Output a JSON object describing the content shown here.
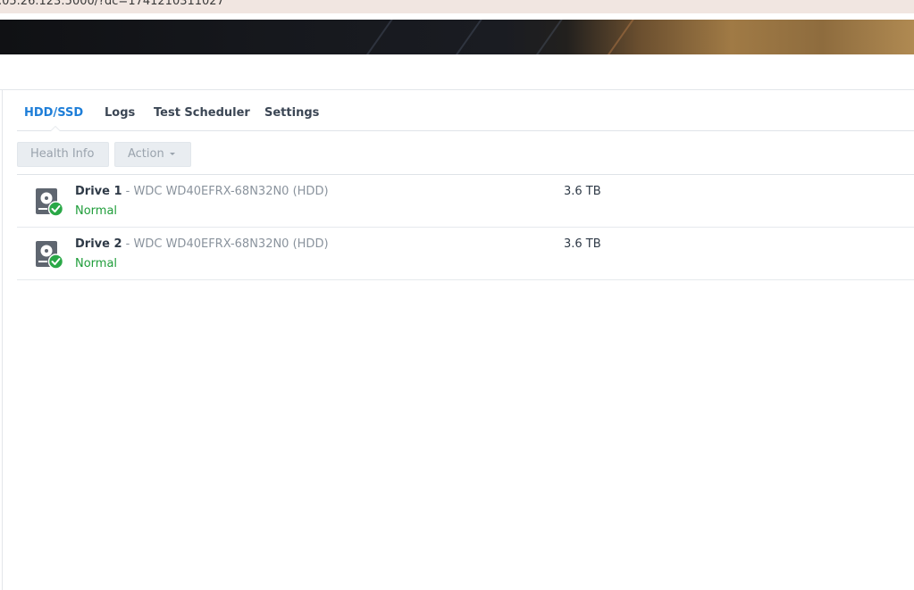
{
  "browser": {
    "url_fragment": ".05.26.123:5000/?dc=1741210311027"
  },
  "tabs": [
    {
      "label": "HDD/SSD",
      "active": true
    },
    {
      "label": "Logs",
      "active": false
    },
    {
      "label": "Test Scheduler",
      "active": false
    },
    {
      "label": "Settings",
      "active": false
    }
  ],
  "toolbar": {
    "health_info_label": "Health Info",
    "action_label": "Action"
  },
  "drives": [
    {
      "name": "Drive 1",
      "separator": " - ",
      "model": "WDC WD40EFRX-68N32N0 (HDD)",
      "status": "Normal",
      "size": "3.6 TB"
    },
    {
      "name": "Drive 2",
      "separator": " - ",
      "model": "WDC WD40EFRX-68N32N0 (HDD)",
      "status": "Normal",
      "size": "3.6 TB"
    }
  ],
  "colors": {
    "accent": "#1e7ed8",
    "status_normal": "#1f9d3a",
    "disabled_button_bg": "#e9edf1",
    "disabled_text": "#9aa3ad"
  },
  "icons": {
    "drive": "hard-drive-icon",
    "status": "check-circle-icon",
    "dropdown": "caret-down-icon"
  }
}
